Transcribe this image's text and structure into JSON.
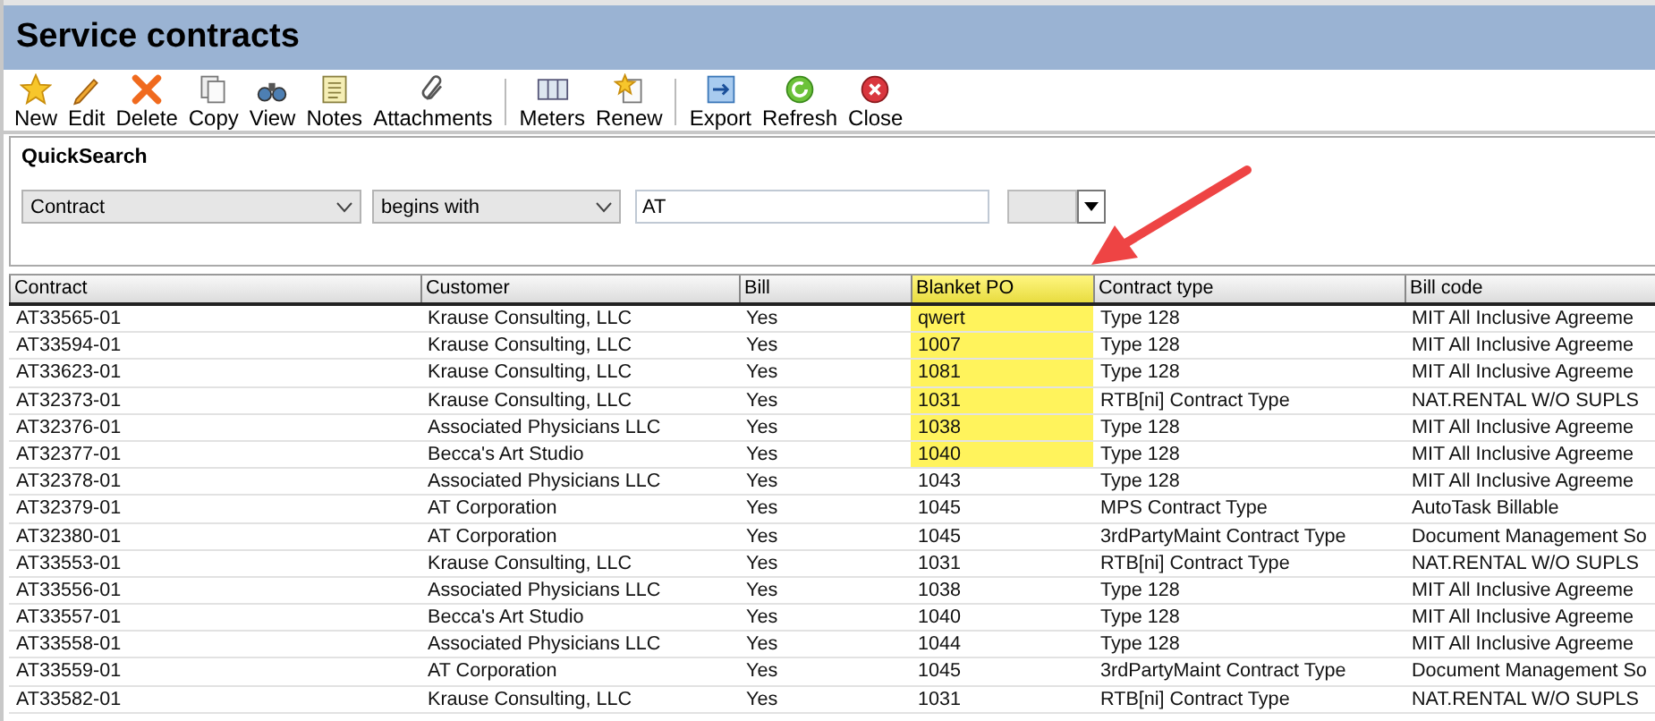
{
  "window": {
    "title": "Service contracts"
  },
  "toolbar": {
    "groups": [
      [
        "New",
        "Edit",
        "Delete",
        "Copy",
        "View",
        "Notes",
        "Attachments"
      ],
      [
        "Meters",
        "Renew"
      ],
      [
        "Export",
        "Refresh",
        "Close"
      ]
    ]
  },
  "quick_search": {
    "label": "QuickSearch",
    "field": "Contract",
    "operator": "begins with",
    "value": "AT"
  },
  "table": {
    "columns": [
      {
        "label": "Contract",
        "highlighted": false
      },
      {
        "label": "Customer",
        "highlighted": false
      },
      {
        "label": "Bill",
        "highlighted": false
      },
      {
        "label": "Blanket PO",
        "highlighted": true
      },
      {
        "label": "Contract type",
        "highlighted": false
      },
      {
        "label": "Bill code",
        "highlighted": false
      }
    ],
    "rows": [
      {
        "cells": [
          "AT33565-01",
          "Krause Consulting, LLC",
          "Yes",
          "qwert",
          "Type 128",
          "MIT All Inclusive Agreeme"
        ],
        "highlighted": true
      },
      {
        "cells": [
          "AT33594-01",
          "Krause Consulting, LLC",
          "Yes",
          "1007",
          "Type 128",
          "MIT All Inclusive Agreeme"
        ],
        "highlighted": true
      },
      {
        "cells": [
          "AT33623-01",
          "Krause Consulting, LLC",
          "Yes",
          "1081",
          "Type 128",
          "MIT All Inclusive Agreeme"
        ],
        "highlighted": true
      },
      {
        "cells": [
          "AT32373-01",
          "Krause Consulting, LLC",
          "Yes",
          "1031",
          "RTB[ni] Contract Type",
          "NAT.RENTAL W/O SUPLS"
        ],
        "highlighted": true
      },
      {
        "cells": [
          "AT32376-01",
          "Associated Physicians LLC",
          "Yes",
          "1038",
          "Type 128",
          "MIT All Inclusive Agreeme"
        ],
        "highlighted": true
      },
      {
        "cells": [
          "AT32377-01",
          "Becca's Art Studio",
          "Yes",
          "1040",
          "Type 128",
          "MIT All Inclusive Agreeme"
        ],
        "highlighted": true
      },
      {
        "cells": [
          "AT32378-01",
          "Associated Physicians LLC",
          "Yes",
          "1043",
          "Type 128",
          "MIT All Inclusive Agreeme"
        ],
        "highlighted": false
      },
      {
        "cells": [
          "AT32379-01",
          "AT Corporation",
          "Yes",
          "1045",
          "MPS Contract Type",
          "AutoTask Billable"
        ],
        "highlighted": false
      },
      {
        "cells": [
          "AT32380-01",
          "AT Corporation",
          "Yes",
          "1045",
          "3rdPartyMaint Contract Type",
          "Document Management So"
        ],
        "highlighted": false
      },
      {
        "cells": [
          "AT33553-01",
          "Krause Consulting, LLC",
          "Yes",
          "1031",
          "RTB[ni] Contract Type",
          "NAT.RENTAL W/O SUPLS"
        ],
        "highlighted": false
      },
      {
        "cells": [
          "AT33556-01",
          "Associated Physicians LLC",
          "Yes",
          "1038",
          "Type 128",
          "MIT All Inclusive Agreeme"
        ],
        "highlighted": false
      },
      {
        "cells": [
          "AT33557-01",
          "Becca's Art Studio",
          "Yes",
          "1040",
          "Type 128",
          "MIT All Inclusive Agreeme"
        ],
        "highlighted": false
      },
      {
        "cells": [
          "AT33558-01",
          "Associated Physicians LLC",
          "Yes",
          "1044",
          "Type 128",
          "MIT All Inclusive Agreeme"
        ],
        "highlighted": false
      },
      {
        "cells": [
          "AT33559-01",
          "AT Corporation",
          "Yes",
          "1045",
          "3rdPartyMaint Contract Type",
          "Document Management So"
        ],
        "highlighted": false
      },
      {
        "cells": [
          "AT33582-01",
          "Krause Consulting, LLC",
          "Yes",
          "1031",
          "RTB[ni] Contract Type",
          "NAT.RENTAL W/O SUPLS"
        ],
        "highlighted": false
      }
    ]
  },
  "annotations": [
    {
      "kind": "arrow"
    }
  ]
}
